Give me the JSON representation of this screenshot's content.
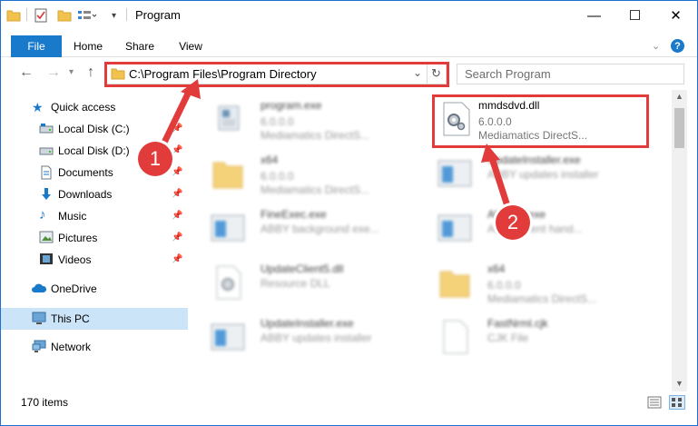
{
  "window": {
    "title": "Program",
    "controls": {
      "minimize": "—",
      "maximize": "☐",
      "close": "✕"
    }
  },
  "ribbon": {
    "tabs": [
      {
        "label": "File"
      },
      {
        "label": "Home"
      },
      {
        "label": "Share"
      },
      {
        "label": "View"
      }
    ]
  },
  "navigation": {
    "address": "C:\\Program Files\\Program Directory",
    "search_placeholder": "Search Program"
  },
  "sidebar": {
    "quick_access": "Quick access",
    "items": [
      {
        "label": "Local Disk (C:)",
        "icon": "drive-icon",
        "pinned": true
      },
      {
        "label": "Local Disk (D:)",
        "icon": "drive-icon",
        "pinned": true
      },
      {
        "label": "Documents",
        "icon": "documents-icon",
        "pinned": true
      },
      {
        "label": "Downloads",
        "icon": "downloads-icon",
        "pinned": true
      },
      {
        "label": "Music",
        "icon": "music-icon",
        "pinned": true
      },
      {
        "label": "Pictures",
        "icon": "pictures-icon",
        "pinned": true
      },
      {
        "label": "Videos",
        "icon": "videos-icon",
        "pinned": true
      }
    ],
    "onedrive": "OneDrive",
    "this_pc": "This PC",
    "network": "Network"
  },
  "files": [
    {
      "name": "program.exe",
      "version": "6.0.0.0",
      "description": "Mediamatics DirectS...",
      "icon": "exe-icon",
      "blurred": true
    },
    {
      "name": "mmdsdvd.dll",
      "version": "6.0.0.0",
      "description": "Mediamatics DirectS...",
      "icon": "dll-gear-icon",
      "blurred": false
    },
    {
      "name": "x64",
      "version": "6.0.0.0",
      "description": "Mediamatics DirectS...",
      "icon": "folder-icon",
      "blurred": true
    },
    {
      "name": "UpdateInstaller.exe",
      "version": "",
      "description": "ABBY updates installer",
      "icon": "window-icon",
      "blurred": true
    },
    {
      "name": "FineExec.exe",
      "version": "",
      "description": "ABBY background exe...",
      "icon": "window-icon",
      "blurred": true
    },
    {
      "name": "AbbyDll.exe",
      "version": "",
      "description": "ABBY event hand...",
      "icon": "window-icon",
      "blurred": true
    },
    {
      "name": "UpdateClient5.dll",
      "version": "",
      "description": "Resource DLL",
      "icon": "dll-icon",
      "blurred": true
    },
    {
      "name": "x64",
      "version": "6.0.0.0",
      "description": "Mediamatics DirectS...",
      "icon": "folder-icon",
      "blurred": true
    },
    {
      "name": "UpdateInstaller.exe",
      "version": "",
      "description": "ABBY updates installer",
      "icon": "window-icon",
      "blurred": true
    },
    {
      "name": "FastNrml.cjk",
      "version": "",
      "description": "CJK File",
      "icon": "blank-file-icon",
      "blurred": true
    }
  ],
  "status": {
    "item_count": "170 items"
  },
  "annotations": {
    "step1": "1",
    "step2": "2",
    "color": "#e23b3b"
  }
}
